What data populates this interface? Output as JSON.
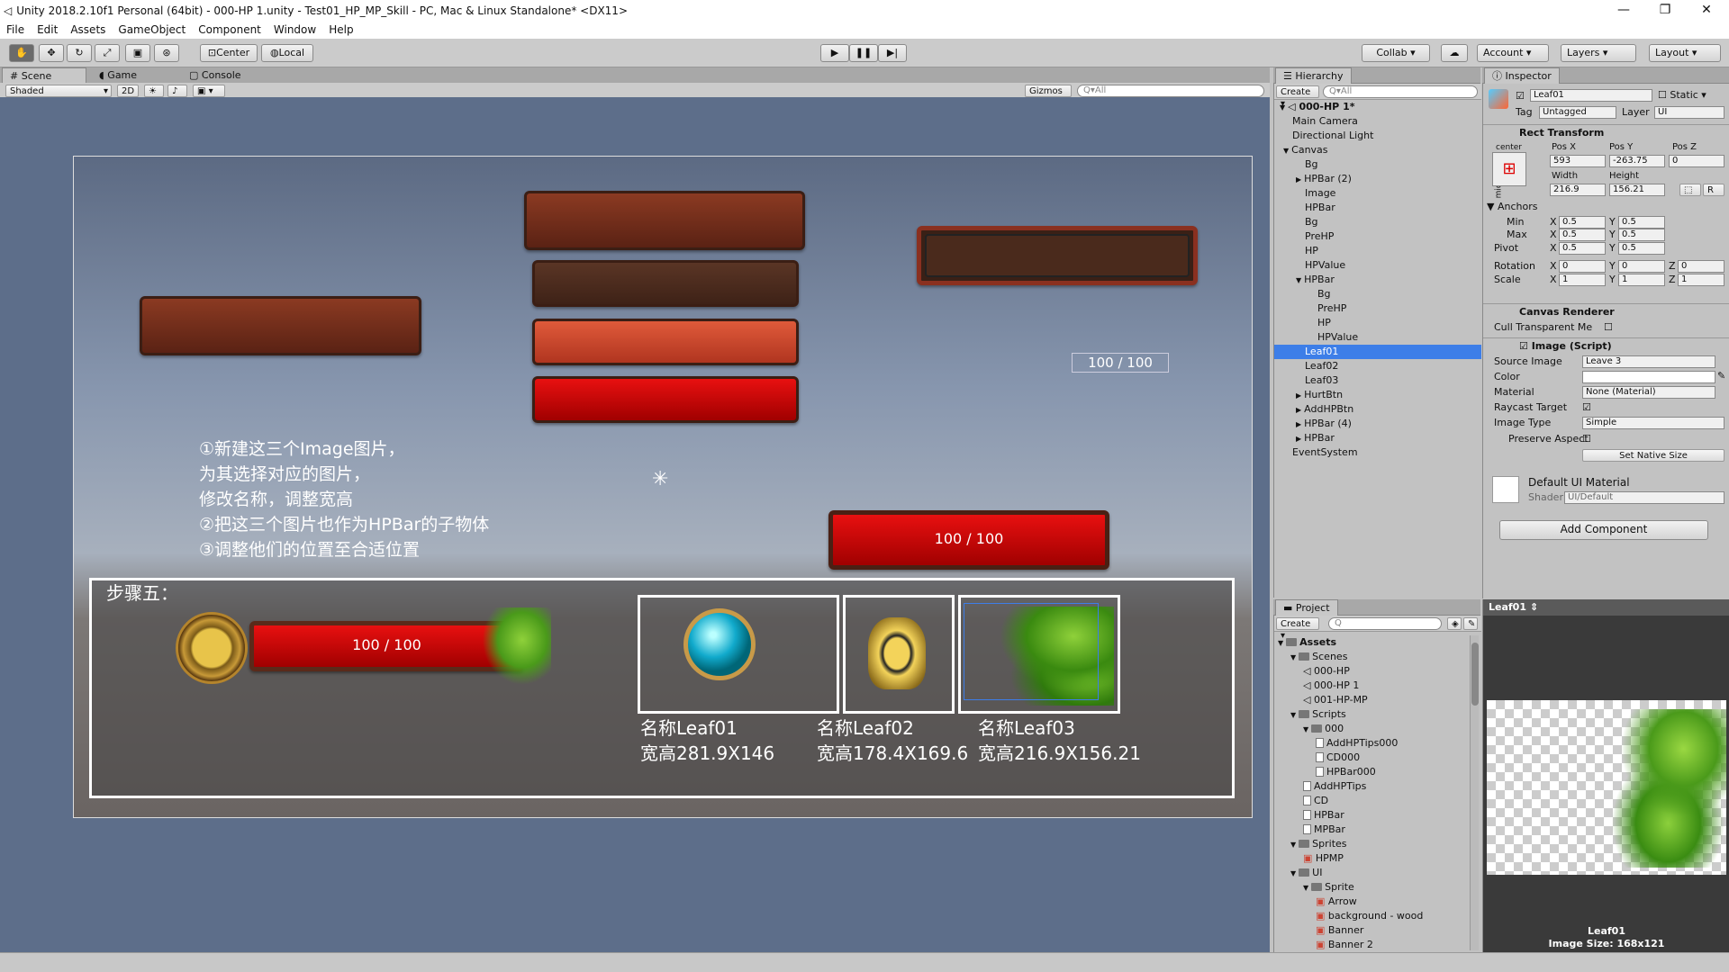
{
  "window": {
    "title": "Unity 2018.2.10f1 Personal (64bit) - 000-HP 1.unity - Test01_HP_MP_Skill - PC, Mac & Linux Standalone* <DX11>",
    "minimize": "—",
    "maximize": "❐",
    "close": "✕"
  },
  "menu": [
    "File",
    "Edit",
    "Assets",
    "GameObject",
    "Component",
    "Window",
    "Help"
  ],
  "toolbar": {
    "pivot": "Center",
    "space": "Local",
    "collab": "Collab ▾",
    "account": "Account",
    "layers": "Layers",
    "layout": "Layout"
  },
  "scene_tabs": {
    "scene": "Scene",
    "game": "Game",
    "console": "Console"
  },
  "scene_bar": {
    "shading": "Shaded",
    "mode2d": "2D",
    "gizmos": "Gizmos",
    "search_placeholder": "All"
  },
  "scene": {
    "hp_text_small": "100 / 100",
    "hp_text_bar": "100 / 100",
    "hp_text_step": "100 / 100",
    "notes": [
      "①新建这三个Image图片，",
      "为其选择对应的图片，",
      "修改名称，调整宽高",
      "②把这三个图片也作为HPBar的子物体",
      "③调整他们的位置至合适位置"
    ],
    "step_label": "步骤五：",
    "captions": [
      {
        "name": "名称Leaf01",
        "size": "宽高281.9X146"
      },
      {
        "name": "名称Leaf02",
        "size": "宽高178.4X169.6"
      },
      {
        "name": "名称Leaf03",
        "size": "宽高216.9X156.21"
      }
    ]
  },
  "hierarchy": {
    "tab": "Hierarchy",
    "create": "Create ▾",
    "search_placeholder": "All",
    "scene": "000-HP 1*",
    "items": [
      {
        "label": "Main Camera",
        "indent": 1,
        "arrow": ""
      },
      {
        "label": "Directional Light",
        "indent": 1,
        "arrow": ""
      },
      {
        "label": "Canvas",
        "indent": 1,
        "arrow": "▼"
      },
      {
        "label": "Bg",
        "indent": 2,
        "arrow": ""
      },
      {
        "label": "HPBar (2)",
        "indent": 2,
        "arrow": "▶"
      },
      {
        "label": "Image",
        "indent": 2,
        "arrow": ""
      },
      {
        "label": "HPBar",
        "indent": 2,
        "arrow": ""
      },
      {
        "label": "Bg",
        "indent": 2,
        "arrow": ""
      },
      {
        "label": "PreHP",
        "indent": 2,
        "arrow": ""
      },
      {
        "label": "HP",
        "indent": 2,
        "arrow": ""
      },
      {
        "label": "HPValue",
        "indent": 2,
        "arrow": ""
      },
      {
        "label": "HPBar",
        "indent": 2,
        "arrow": "▼"
      },
      {
        "label": "Bg",
        "indent": 3,
        "arrow": ""
      },
      {
        "label": "PreHP",
        "indent": 3,
        "arrow": ""
      },
      {
        "label": "HP",
        "indent": 3,
        "arrow": ""
      },
      {
        "label": "HPValue",
        "indent": 3,
        "arrow": ""
      },
      {
        "label": "Leaf01",
        "indent": 2,
        "arrow": "",
        "selected": true
      },
      {
        "label": "Leaf02",
        "indent": 2,
        "arrow": ""
      },
      {
        "label": "Leaf03",
        "indent": 2,
        "arrow": ""
      },
      {
        "label": "HurtBtn",
        "indent": 2,
        "arrow": "▶"
      },
      {
        "label": "AddHPBtn",
        "indent": 2,
        "arrow": "▶"
      },
      {
        "label": "HPBar (4)",
        "indent": 2,
        "arrow": "▶"
      },
      {
        "label": "HPBar",
        "indent": 2,
        "arrow": "▶"
      },
      {
        "label": "EventSystem",
        "indent": 1,
        "arrow": ""
      }
    ]
  },
  "inspector": {
    "tab": "Inspector",
    "object_name": "Leaf01",
    "static": "Static",
    "tag_label": "Tag",
    "tag": "Untagged",
    "layer_label": "Layer",
    "layer": "UI",
    "rect_transform": "Rect Transform",
    "anchor_preset": "center",
    "middle": "middle",
    "pos_x_label": "Pos X",
    "pos_y_label": "Pos Y",
    "pos_z_label": "Pos Z",
    "pos_x": "593",
    "pos_y": "-263.75",
    "pos_z": "0",
    "width_label": "Width",
    "height_label": "Height",
    "width": "216.9",
    "height": "156.21",
    "anchors": "Anchors",
    "min": "Min",
    "max": "Max",
    "pivot": "Pivot",
    "rotation": "Rotation",
    "scale": "Scale",
    "min_x": "0.5",
    "min_y": "0.5",
    "max_x": "0.5",
    "max_y": "0.5",
    "pivot_x": "0.5",
    "pivot_y": "0.5",
    "rot_x": "0",
    "rot_y": "0",
    "rot_z": "0",
    "scale_x": "1",
    "scale_y": "1",
    "scale_z": "1",
    "canvas_renderer": "Canvas Renderer",
    "cull": "Cull Transparent Me",
    "image_script": "Image (Script)",
    "source_image_label": "Source Image",
    "source_image": "Leave 3",
    "color_label": "Color",
    "material_label": "Material",
    "material": "None (Material)",
    "raycast_label": "Raycast Target",
    "image_type_label": "Image Type",
    "image_type": "Simple",
    "preserve_label": "Preserve Aspect",
    "set_native": "Set Native Size",
    "default_material": "Default UI Material",
    "shader_label": "Shader",
    "shader": "UI/Default",
    "add_component": "Add Component"
  },
  "project": {
    "tab": "Project",
    "create": "Create ▾",
    "items": [
      {
        "label": "Assets",
        "indent": 0,
        "type": "folder",
        "bold": true
      },
      {
        "label": "Scenes",
        "indent": 1,
        "type": "folder"
      },
      {
        "label": "000-HP",
        "indent": 2,
        "type": "scene"
      },
      {
        "label": "000-HP 1",
        "indent": 2,
        "type": "scene"
      },
      {
        "label": "001-HP-MP",
        "indent": 2,
        "type": "scene"
      },
      {
        "label": "Scripts",
        "indent": 1,
        "type": "folder"
      },
      {
        "label": "000",
        "indent": 2,
        "type": "folder"
      },
      {
        "label": "AddHPTips000",
        "indent": 3,
        "type": "cs"
      },
      {
        "label": "CD000",
        "indent": 3,
        "type": "cs"
      },
      {
        "label": "HPBar000",
        "indent": 3,
        "type": "cs"
      },
      {
        "label": "AddHPTips",
        "indent": 2,
        "type": "cs"
      },
      {
        "label": "CD",
        "indent": 2,
        "type": "cs"
      },
      {
        "label": "HPBar",
        "indent": 2,
        "type": "cs"
      },
      {
        "label": "MPBar",
        "indent": 2,
        "type": "cs"
      },
      {
        "label": "Sprites",
        "indent": 1,
        "type": "folder"
      },
      {
        "label": "HPMP",
        "indent": 2,
        "type": "sprite"
      },
      {
        "label": "UI",
        "indent": 1,
        "type": "folder"
      },
      {
        "label": "Sprite",
        "indent": 2,
        "type": "folder"
      },
      {
        "label": "Arrow",
        "indent": 3,
        "type": "sprite"
      },
      {
        "label": "background - wood",
        "indent": 3,
        "type": "sprite"
      },
      {
        "label": "Banner",
        "indent": 3,
        "type": "sprite"
      },
      {
        "label": "Banner 2",
        "indent": 3,
        "type": "sprite"
      }
    ]
  },
  "preview": {
    "title": "Leaf01 ⇕",
    "name": "Leaf01",
    "size": "Image Size: 168x121"
  },
  "colors": {
    "selection": "#3d7ee8",
    "hp_red": "#e81010"
  }
}
